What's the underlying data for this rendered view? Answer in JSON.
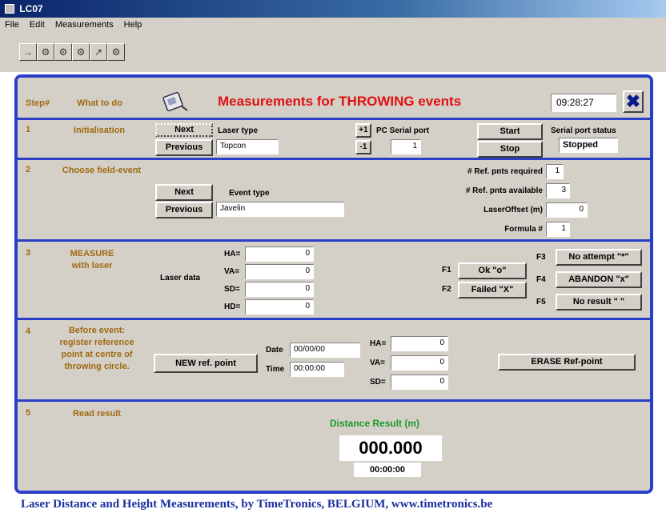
{
  "app": {
    "title": "LC07"
  },
  "menu": [
    "File",
    "Edit",
    "Measurements",
    "Help"
  ],
  "toolbar": {
    "buttons": [
      "arrow-icon",
      "tool-icon",
      "tool-icon",
      "tool-icon",
      "arrow-icon",
      "tool-icon"
    ]
  },
  "header": {
    "step_label": "Step#",
    "what_label": "What to do",
    "title": "Measurements for THROWING events",
    "clock": "09:28:27",
    "close": "✖"
  },
  "s1": {
    "num": "1",
    "label": "Initialisation",
    "next": "Next",
    "previous": "Previous",
    "laser_type_label": "Laser type",
    "laser_type": "Topcon",
    "plus": "+1",
    "minus": "-1",
    "serial_label": "PC Serial port",
    "serial_value": "1",
    "start": "Start",
    "stop": "Stop",
    "status_label": "Serial port status",
    "status": "Stopped"
  },
  "s2": {
    "num": "2",
    "label": "Choose field-event",
    "next": "Next",
    "previous": "Previous",
    "event_type_label": "Event type",
    "event_type": "Javelin",
    "req_label": "# Ref. pnts required",
    "req": "1",
    "avail_label": "# Ref. pnts available",
    "avail": "3",
    "offset_label": "LaserOffset (m)",
    "offset": "0",
    "formula_label": "Formula #",
    "formula": "1"
  },
  "s3": {
    "num": "3",
    "label": "MEASURE with laser",
    "laser_data_label": "Laser data",
    "rows": [
      {
        "key": "HA=",
        "value": "0"
      },
      {
        "key": "VA=",
        "value": "0"
      },
      {
        "key": "SD=",
        "value": "0"
      },
      {
        "key": "HD=",
        "value": "0"
      }
    ],
    "f1": "F1",
    "f2": "F2",
    "f3": "F3",
    "f4": "F4",
    "f5": "F5",
    "ok": "Ok \"o\"",
    "failed": "Failed \"X\"",
    "no_attempt": "No attempt \"*\"",
    "abandon": "ABANDON \"x\"",
    "no_result": "No result \" \""
  },
  "s4": {
    "num": "4",
    "label": "Before event: register reference point at centre of throwing circle.",
    "new_ref": "NEW ref. point",
    "date_label": "Date",
    "date": "00/00/00",
    "time_label": "Time",
    "time": "00:00:00",
    "rows": [
      {
        "key": "HA=",
        "value": "0"
      },
      {
        "key": "VA=",
        "value": "0"
      },
      {
        "key": "SD=",
        "value": "0"
      }
    ],
    "erase": "ERASE Ref-point"
  },
  "s5": {
    "num": "5",
    "label": "Read result",
    "distance_label": "Distance Result (m)",
    "distance": "000.000",
    "time": "00:00:00"
  },
  "footer": "Laser Distance and Height Measurements, by TimeTronics, BELGIUM, www.timetronics.be"
}
